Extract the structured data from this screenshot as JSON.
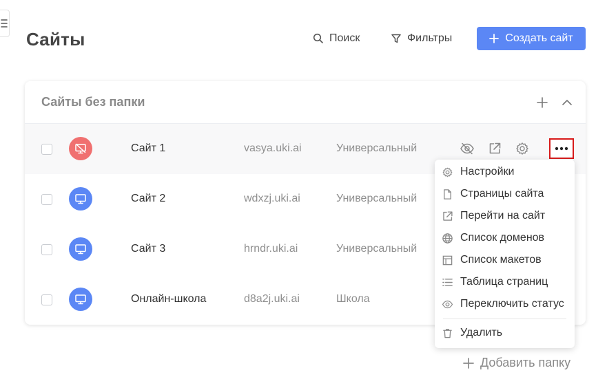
{
  "page": {
    "title": "Сайты"
  },
  "toolbar": {
    "search_label": "Поиск",
    "filters_label": "Фильтры",
    "create_label": "Создать сайт"
  },
  "folder": {
    "title": "Сайты без папки"
  },
  "sites": [
    {
      "name": "Сайт 1",
      "domain": "vasya.uki.ai",
      "type": "Универсальный",
      "status": "disabled"
    },
    {
      "name": "Сайт 2",
      "domain": "wdxzj.uki.ai",
      "type": "Универсальный",
      "status": "active"
    },
    {
      "name": "Сайт 3",
      "domain": "hrndr.uki.ai",
      "type": "Универсальный",
      "status": "active"
    },
    {
      "name": "Онлайн-школа",
      "domain": "d8a2j.uki.ai",
      "type": "Школа",
      "status": "active"
    }
  ],
  "context_menu": {
    "items": [
      {
        "label": "Настройки",
        "icon": "gear-icon"
      },
      {
        "label": "Страницы сайта",
        "icon": "file-icon"
      },
      {
        "label": "Перейти на сайт",
        "icon": "external-link-icon"
      },
      {
        "label": "Список доменов",
        "icon": "globe-icon"
      },
      {
        "label": "Список макетов",
        "icon": "layout-icon"
      },
      {
        "label": "Таблица страниц",
        "icon": "list-icon"
      },
      {
        "label": "Переключить статус",
        "icon": "eye-icon"
      }
    ],
    "delete_label": "Удалить"
  },
  "footer": {
    "add_folder_label": "Добавить папку"
  },
  "colors": {
    "accent": "#5b87f5",
    "disabled_avatar": "#f07070",
    "highlight": "#d81b1b"
  }
}
